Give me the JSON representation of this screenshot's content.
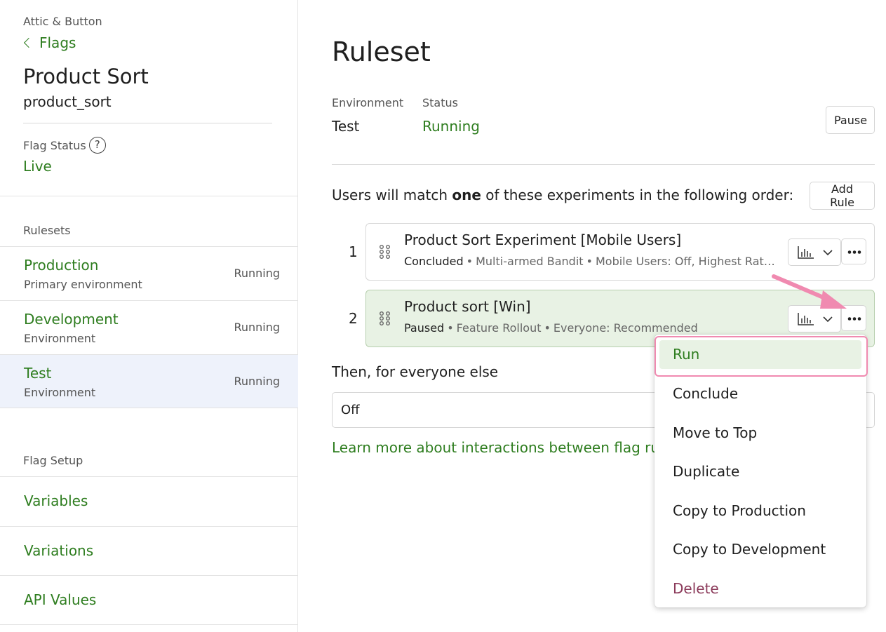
{
  "sidebar": {
    "org": "Attic & Button",
    "back_label": "Flags",
    "flag_title": "Product Sort",
    "flag_key": "product_sort",
    "flag_status_label": "Flag Status",
    "flag_status_value": "Live",
    "help_glyph": "?",
    "rulesets_label": "Rulesets",
    "rulesets": [
      {
        "name": "Production",
        "desc": "Primary environment",
        "status": "Running"
      },
      {
        "name": "Development",
        "desc": "Environment",
        "status": "Running"
      },
      {
        "name": "Test",
        "desc": "Environment",
        "status": "Running"
      }
    ],
    "setup_label": "Flag Setup",
    "setup_items": [
      "Variables",
      "Variations",
      "API Values"
    ]
  },
  "main": {
    "title": "Ruleset",
    "environment_label": "Environment",
    "environment_value": "Test",
    "status_label": "Status",
    "status_value": "Running",
    "pause_label": "Pause",
    "match_prefix": "Users will match ",
    "match_bold": "one",
    "match_suffix": " of these experiments in the following order:",
    "add_rule_label": "Add Rule",
    "rules": [
      {
        "num": "1",
        "title": "Product Sort Experiment [Mobile Users]",
        "status": "Concluded",
        "type": "Multi-armed Bandit",
        "target": "Mobile Users: Off, Highest Rated"
      },
      {
        "num": "2",
        "title": "Product sort [Win]",
        "status": "Paused",
        "type": "Feature Rollout",
        "target": "Everyone: Recommended"
      }
    ],
    "else_label": "Then, for everyone else",
    "else_value": "Off",
    "learn_link": "Learn more about interactions between flag rules"
  },
  "menu": {
    "items": [
      "Run",
      "Conclude",
      "Move to Top",
      "Duplicate",
      "Copy to Production",
      "Copy to Development",
      "Delete"
    ]
  },
  "colors": {
    "accent_green": "#2e7d1f",
    "selected_bg": "#e8f2e4",
    "highlight_pink": "#f08ab0",
    "delete": "#8b3a5a"
  }
}
